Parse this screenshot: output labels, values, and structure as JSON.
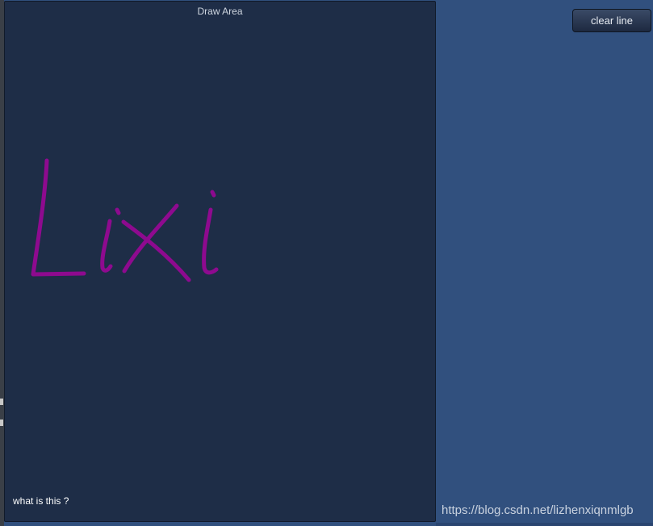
{
  "draw_area": {
    "title": "Draw Area",
    "caption": "what is this ?",
    "stroke_color": "#8e0a8f",
    "background": "#1e2d47"
  },
  "toolbar": {
    "clear_label": "clear line"
  },
  "footer": {
    "watermark": "https://blog.csdn.net/lizhenxiqnmlgb"
  },
  "colors": {
    "canvas_bg": "#31507e",
    "button_bg": "#25324a"
  }
}
